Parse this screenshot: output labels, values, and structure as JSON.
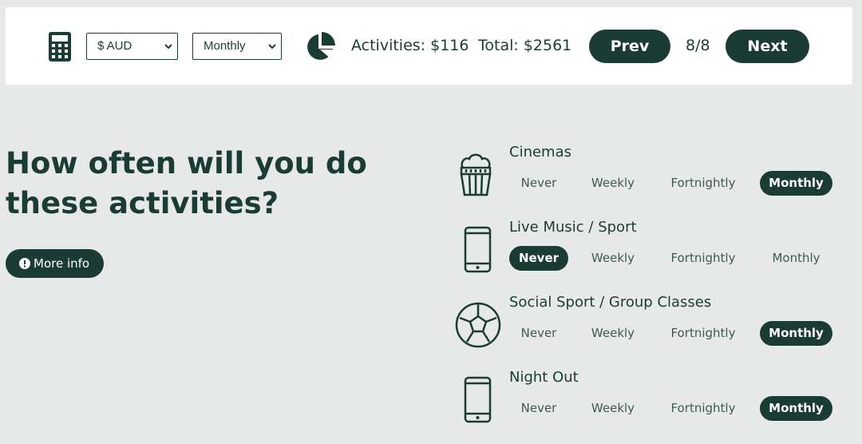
{
  "toolbar": {
    "calculator_icon": "calculator-icon",
    "currency": {
      "selected": "$ AUD"
    },
    "frequency": {
      "selected": "Monthly"
    },
    "pie_icon": "pie-chart-icon",
    "activities_label": "Activities: $116",
    "total_label": "Total: $2561",
    "prev_label": "Prev",
    "page": "8/8",
    "next_label": "Next"
  },
  "main": {
    "heading": "How often will you do these activities?",
    "more_info_label": "More info",
    "more_info_icon": "info-icon"
  },
  "activities": [
    {
      "title": "Cinemas",
      "icon": "popcorn-icon",
      "options": [
        "Never",
        "Weekly",
        "Fortnightly",
        "Monthly"
      ],
      "selected": "Monthly"
    },
    {
      "title": "Live Music / Sport",
      "icon": "mobile-phone-icon",
      "options": [
        "Never",
        "Weekly",
        "Fortnightly",
        "Monthly"
      ],
      "selected": "Never"
    },
    {
      "title": "Social Sport / Group Classes",
      "icon": "soccer-ball-icon",
      "options": [
        "Never",
        "Weekly",
        "Fortnightly",
        "Monthly"
      ],
      "selected": "Monthly"
    },
    {
      "title": "Night Out",
      "icon": "mobile-phone-icon",
      "options": [
        "Never",
        "Weekly",
        "Fortnightly",
        "Monthly"
      ],
      "selected": "Monthly"
    }
  ],
  "colors": {
    "primary": "#1b3c34",
    "background": "#e6e9e8",
    "surface": "#ffffff"
  }
}
